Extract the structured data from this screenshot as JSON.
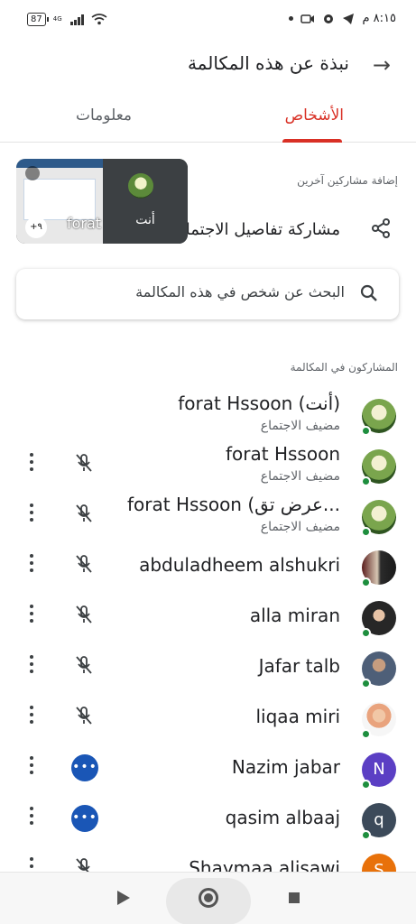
{
  "status_bar": {
    "battery": "87",
    "network": "4G",
    "time": "٨:١٥ م"
  },
  "header": {
    "title": "نبذة عن هذه المكالمة"
  },
  "tabs": [
    {
      "label": "الأشخاص",
      "active": true
    },
    {
      "label": "معلومات",
      "active": false
    }
  ],
  "add_participants": {
    "label": "إضافة مشاركين آخرين",
    "share_label": "مشاركة تفاصيل الاجتماع"
  },
  "self_view": {
    "screen_name": "forat",
    "more_count": "+٩",
    "self_label": "أنت"
  },
  "search": {
    "placeholder": "البحث عن شخص في هذه المكالمة"
  },
  "participants_label": "المشاركون في المكالمة",
  "participants": [
    {
      "name": "forat Hssoon (أنت)",
      "role": "مضيف الاجتماع",
      "mic": "none"
    },
    {
      "name": "forat Hssoon",
      "role": "مضيف الاجتماع",
      "mic": "muted"
    },
    {
      "name": "forat Hssoon (عرض تق...",
      "role": "مضيف الاجتماع",
      "mic": "muted"
    },
    {
      "name": "abduladheem alshukri",
      "role": "",
      "mic": "muted"
    },
    {
      "name": "alla miran",
      "role": "",
      "mic": "muted"
    },
    {
      "name": "Jafar talb",
      "role": "",
      "mic": "muted"
    },
    {
      "name": "liqaa miri",
      "role": "",
      "mic": "muted"
    },
    {
      "name": "Nazim jabar",
      "role": "",
      "mic": "speaking",
      "initial": "N"
    },
    {
      "name": "qasim albaaj",
      "role": "",
      "mic": "speaking",
      "initial": "q"
    },
    {
      "name": "Shaymaa alisawi",
      "role": "",
      "mic": "muted",
      "initial": "S"
    }
  ],
  "colors": {
    "accent": "#d93025",
    "speaking": "#1a56b6",
    "presence": "#1e8e3e"
  }
}
